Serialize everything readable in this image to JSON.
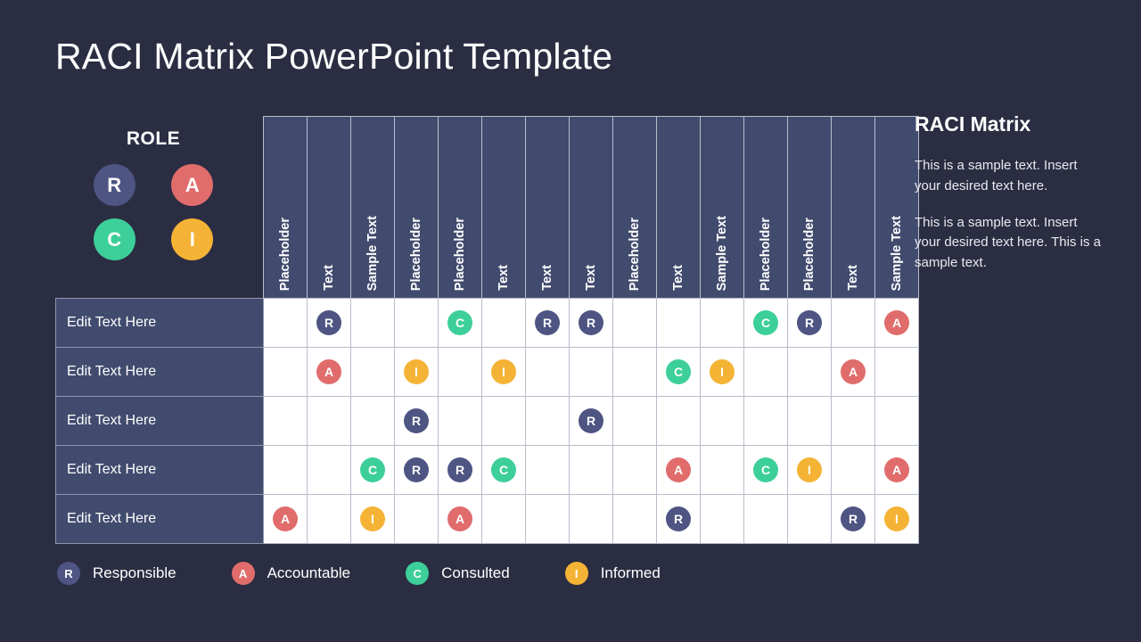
{
  "slide": {
    "title": "RACI Matrix PowerPoint Template",
    "background_color": "#2b2d42"
  },
  "role_legend": {
    "heading": "ROLE",
    "badges": [
      {
        "letter": "R",
        "color": "#4e5583"
      },
      {
        "letter": "A",
        "color": "#e06c6c"
      },
      {
        "letter": "C",
        "color": "#3dcf9a"
      },
      {
        "letter": "I",
        "color": "#f5b335"
      }
    ]
  },
  "role_colors": {
    "R": "#4e5583",
    "A": "#e06c6c",
    "C": "#3dcf9a",
    "I": "#f5b335"
  },
  "matrix": {
    "header_bg": "#414b6e",
    "cell_bg": "#ffffff",
    "grid_color": "#b9bdcc",
    "columns": [
      "Placeholder",
      "Text",
      "Sample Text",
      "Placeholder",
      "Placeholder",
      "Text",
      "Text",
      "Text",
      "Placeholder",
      "Text",
      "Sample Text",
      "Placeholder",
      "Placeholder",
      "Text",
      "Sample Text"
    ],
    "rows": [
      {
        "label": "Edit Text Here",
        "cells": [
          "",
          "R",
          "",
          "",
          "C",
          "",
          "R",
          "R",
          "",
          "",
          "",
          "C",
          "R",
          "",
          "A"
        ]
      },
      {
        "label": "Edit Text Here",
        "cells": [
          "",
          "A",
          "",
          "I",
          "",
          "I",
          "",
          "",
          "",
          "C",
          "I",
          "",
          "",
          "A",
          ""
        ]
      },
      {
        "label": "Edit Text Here",
        "cells": [
          "",
          "",
          "",
          "R",
          "",
          "",
          "",
          "R",
          "",
          "",
          "",
          "",
          "",
          "",
          ""
        ]
      },
      {
        "label": "Edit Text Here",
        "cells": [
          "",
          "",
          "C",
          "R",
          "R",
          "C",
          "",
          "",
          "",
          "A",
          "",
          "C",
          "I",
          "",
          "A"
        ]
      },
      {
        "label": "Edit Text Here",
        "cells": [
          "A",
          "",
          "I",
          "",
          "A",
          "",
          "",
          "",
          "",
          "R",
          "",
          "",
          "",
          "R",
          "I"
        ]
      }
    ]
  },
  "side_panel": {
    "title": "RACI Matrix",
    "paragraphs": [
      "This is a sample text. Insert your desired text here.",
      "This is a sample text. Insert your desired text here. This is a sample text."
    ]
  },
  "bottom_legend": [
    {
      "letter": "R",
      "label": "Responsible",
      "color": "#4e5583"
    },
    {
      "letter": "A",
      "label": "Accountable",
      "color": "#e06c6c"
    },
    {
      "letter": "C",
      "label": "Consulted",
      "color": "#3dcf9a"
    },
    {
      "letter": "I",
      "label": "Informed",
      "color": "#f5b335"
    }
  ]
}
